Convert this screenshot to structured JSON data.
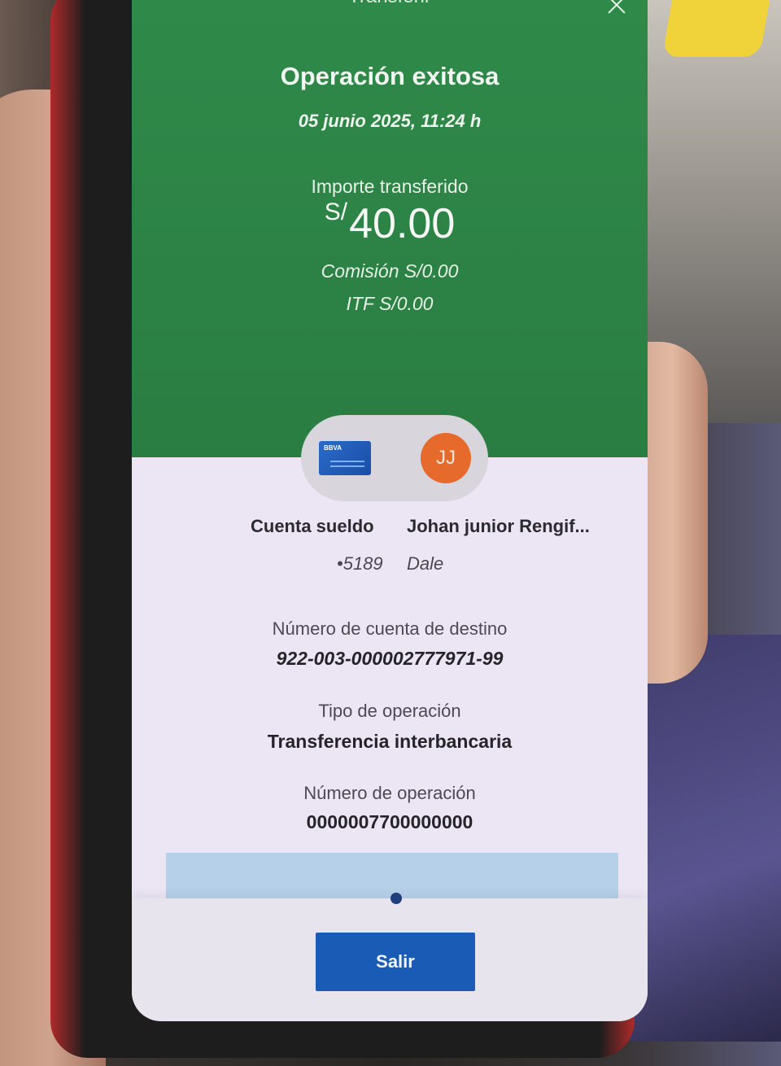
{
  "header": {
    "title": "Transferir",
    "close_icon": "close-icon"
  },
  "status": {
    "title": "Operación exitosa",
    "datetime": "05 junio 2025, 11:24 h"
  },
  "amount": {
    "label": "Importe transferido",
    "currency": "S/",
    "value": "40.00",
    "commission": "Comisión  S/0.00",
    "itf": "ITF  S/0.00"
  },
  "origin": {
    "icon": "bank-card-icon",
    "brand": "BBVA",
    "name": "Cuenta sueldo",
    "number": "•5189"
  },
  "destination": {
    "initials": "JJ",
    "name": "Johan junior Rengif...",
    "note": "Dale"
  },
  "details": {
    "account_label": "Número de cuenta de destino",
    "account_value": "922-003-000002777971-99",
    "type_label": "Tipo de operación",
    "type_value": "Transferencia interbancaria",
    "operation_label": "Número de operación",
    "operation_value": "0000007700000000"
  },
  "footer": {
    "exit_label": "Salir"
  },
  "colors": {
    "success_green": "#2f8a49",
    "primary_blue": "#1a5bb5",
    "avatar_orange": "#e56a2c"
  }
}
